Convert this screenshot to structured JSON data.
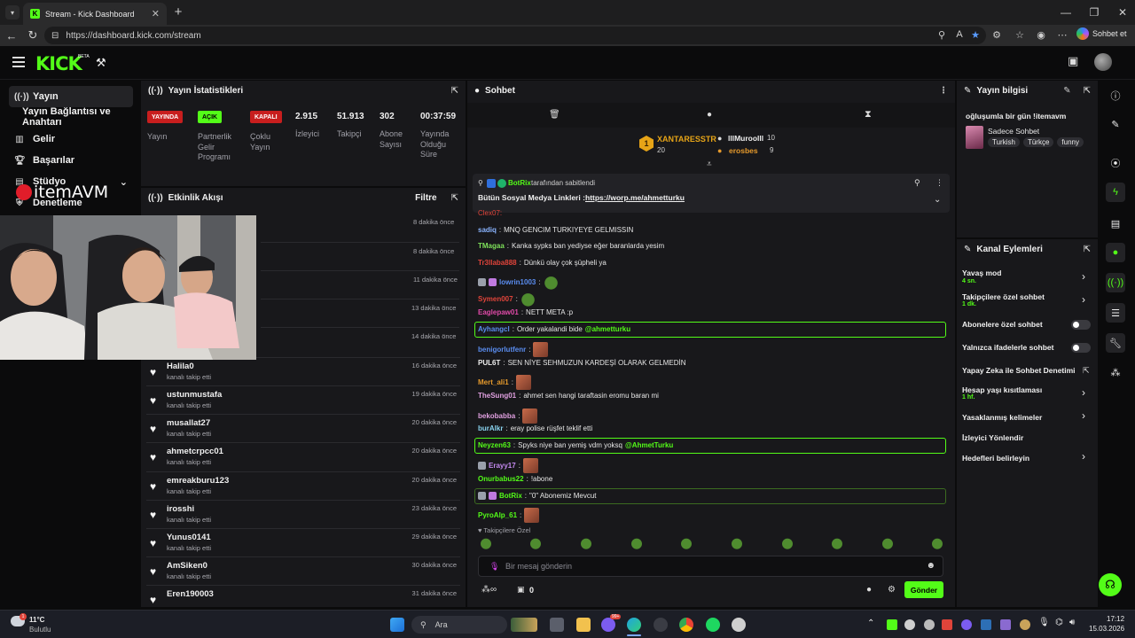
{
  "browser": {
    "tab_title": "Stream - Kick Dashboard",
    "url": "https://dashboard.kick.com/stream",
    "copilot_label": "Sohbet et",
    "tab_icon": "K"
  },
  "header": {
    "logo": "KICK",
    "beta": "BETA"
  },
  "sidebar": {
    "items": [
      {
        "label": "Yayın"
      },
      {
        "label": "Yayın Bağlantısı ve Anahtarı"
      },
      {
        "label": "Gelir"
      },
      {
        "label": "Başarılar"
      },
      {
        "label": "Stüdyo"
      },
      {
        "label": "Denetleme"
      }
    ]
  },
  "stream_stats": {
    "title": "Yayın İstatistikleri",
    "status": [
      {
        "badge": "YAYINDA",
        "label": "Yayın",
        "color": "#c81e1e"
      },
      {
        "badge": "AÇIK",
        "label": "Partnerlik Gelir Programı",
        "color": "#53fc18"
      },
      {
        "badge": "KAPALI",
        "label": "Çoklu Yayın",
        "color": "#c81e1e"
      }
    ],
    "metrics": [
      {
        "value": "2.915",
        "label": "İzleyici"
      },
      {
        "value": "51.913",
        "label": "Takipçi"
      },
      {
        "value": "302",
        "label": "Abone Sayısı"
      },
      {
        "value": "00:37:59",
        "label": "Yayında Olduğu Süre"
      }
    ]
  },
  "activity": {
    "title": "Etkinlik Akışı",
    "filter": "Filtre",
    "hidden_times": [
      "8 dakika önce",
      "8 dakika önce",
      "11 dakika önce",
      "13 dakika önce",
      "14 dakika önce"
    ],
    "rows": [
      {
        "name": "Halila0",
        "sub": "kanalı takip etti",
        "time": "16 dakika önce"
      },
      {
        "name": "ustunmustafa",
        "sub": "kanalı takip etti",
        "time": "19 dakika önce"
      },
      {
        "name": "musallat27",
        "sub": "kanalı takip etti",
        "time": "20 dakika önce"
      },
      {
        "name": "ahmetcrpcc01",
        "sub": "kanalı takip etti",
        "time": "20 dakika önce"
      },
      {
        "name": "emreakburu123",
        "sub": "kanalı takip etti",
        "time": "20 dakika önce"
      },
      {
        "name": "irosshi",
        "sub": "kanalı takip etti",
        "time": "23 dakika önce"
      },
      {
        "name": "Yunus0141",
        "sub": "kanalı takip etti",
        "time": "29 dakika önce"
      },
      {
        "name": "AmSiken0",
        "sub": "kanalı takip etti",
        "time": "30 dakika önce"
      },
      {
        "name": "Eren190003",
        "sub": "",
        "time": "31 dakika önce"
      }
    ]
  },
  "overlay": {
    "brand": "itemAVM"
  },
  "chat": {
    "title": "Sohbet",
    "leaders": {
      "rank": "1",
      "first": {
        "name": "XANTARESSTR",
        "count": "20"
      },
      "second": {
        "name": "lllMuroolll",
        "count": "10"
      },
      "third": {
        "name": "erosbes",
        "count": "9"
      }
    },
    "pinned": {
      "by_user": "BotRix",
      "by_suffix": "tarafından sabitlendi",
      "text": "Bütün Sosyal Medya Linkleri :",
      "link": "https://worp.me/ahmetturku"
    },
    "messages": [
      {
        "user": "sadiq",
        "color": "#8ab4ff",
        "text": "MNQ GENCIM TURKIYEYE GELMISSIN"
      },
      {
        "user": "TMagaa",
        "color": "#7ee05a",
        "text": "Kanka sypks ban yediyse eğer baranlarda yesim"
      },
      {
        "user": "Tr3llaba888",
        "color": "#e0443a",
        "text": "Dünkü olay çok şüpheli ya"
      },
      {
        "user": "lowrin1003",
        "color": "#5a8df0",
        "text": ""
      },
      {
        "user": "Symen007",
        "color": "#e0443a",
        "text": ""
      },
      {
        "user": "Eaglepaw01",
        "color": "#e04aa8",
        "text": "NETT META :p"
      },
      {
        "user": "Ayhangcl",
        "color": "#5a8df0",
        "text": "Order yakalandi bide",
        "mention": "@ahmetturku"
      },
      {
        "user": "benigorlutfenr",
        "color": "#5a8df0",
        "text": ""
      },
      {
        "user": "PUL6T",
        "color": "#f0f0f0",
        "text": "SEN NİYE SEHMUZUN KARDEŞİ OLARAK GELMEDİN"
      },
      {
        "user": "Mert_ali1",
        "color": "#e69a2c",
        "text": ""
      },
      {
        "user": "TheSung01",
        "color": "#e0a0e0",
        "text": "ahmet sen hangi taraftasin eromu baran mi"
      },
      {
        "user": "bekobabba",
        "color": "#e0a0e0",
        "text": ""
      },
      {
        "user": "burAlkr",
        "color": "#8ad4f0",
        "text": "eray polise rüşfet teklif etti"
      },
      {
        "user": "Neyzen63",
        "color": "#53fc18",
        "text": "Spyks niye ban yemiş vdm yoksq",
        "mention": "@AhmetTurku"
      },
      {
        "user": "Erayy17",
        "color": "#c48af0",
        "text": ""
      },
      {
        "user": "Onurbabus22",
        "color": "#53fc18",
        "text": "!abone"
      },
      {
        "user": "BotRix",
        "color": "#53fc18",
        "text": "\"0\" Abonemiz Mevcut"
      },
      {
        "user": "PyroAlp_61",
        "color": "#53fc18",
        "text": ""
      }
    ],
    "followers_only": "Takipçilere Özel",
    "input_placeholder": "Bir mesaj gönderin",
    "points": "0",
    "send_label": "Gönder"
  },
  "stream_info": {
    "title": "Yayın bilgisi",
    "stream_title": "oğluşumla bir gün !itemavm",
    "category": "Sadece Sohbet",
    "tags": [
      "Turkish",
      "Türkçe",
      "funny"
    ]
  },
  "channel_actions": {
    "title": "Kanal Eylemleri",
    "items": [
      {
        "label": "Yavaş mod",
        "sub": "4 sn."
      },
      {
        "label": "Takipçilere özel sohbet",
        "sub": "1 dk."
      },
      {
        "label": "Abonelere özel sohbet",
        "sub": ""
      },
      {
        "label": "Yalnızca ifadelerle sohbet",
        "sub": ""
      },
      {
        "label": "Yapay Zeka ile Sohbet Denetimi",
        "sub": ""
      },
      {
        "label": "Hesap yaşı kısıtlaması",
        "sub": "1 hf."
      },
      {
        "label": "Yasaklanmış kelimeler",
        "sub": ""
      },
      {
        "label": "İzleyici Yönlendir",
        "sub": ""
      },
      {
        "label": "Hedefleri belirleyin",
        "sub": ""
      }
    ]
  },
  "taskbar": {
    "weather_temp": "11°C",
    "weather_desc": "Bulutlu",
    "search_placeholder": "Ara",
    "time": "17:12",
    "date": "15.03.2026",
    "badge_count": "99+"
  },
  "colors": {
    "accent": "#53fc18",
    "live_red": "#c81e1e",
    "panel_bg": "#18181b"
  }
}
